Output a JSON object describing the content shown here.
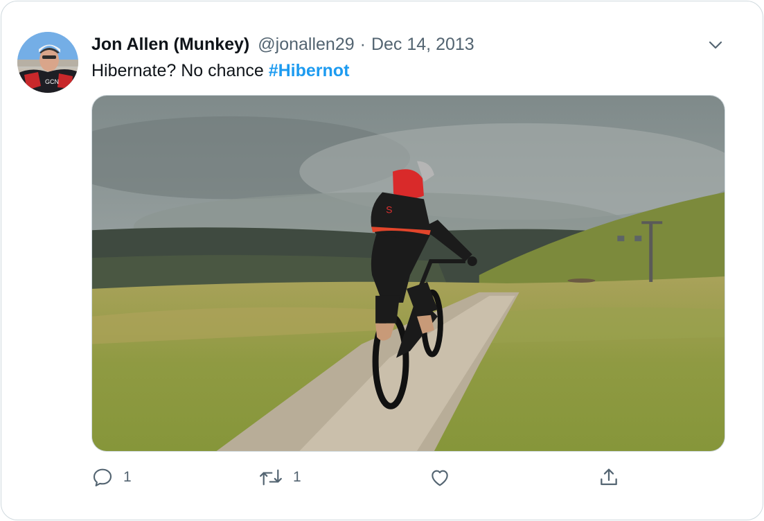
{
  "tweet": {
    "author_name": "Jon Allen (Munkey)",
    "handle": "@jonallen29",
    "separator": "·",
    "date": "Dec 14, 2013",
    "text": "Hibernate? No chance ",
    "hashtag": "#Hibernot"
  },
  "actions": {
    "reply_count": "1",
    "retweet_count": "1"
  },
  "colors": {
    "link": "#1d9bf0",
    "secondary_text": "#536471",
    "border": "#cfd9de"
  },
  "icons": {
    "caret": "chevron-down-icon",
    "reply": "reply-icon",
    "retweet": "retweet-icon",
    "like": "heart-icon",
    "share": "share-icon"
  }
}
